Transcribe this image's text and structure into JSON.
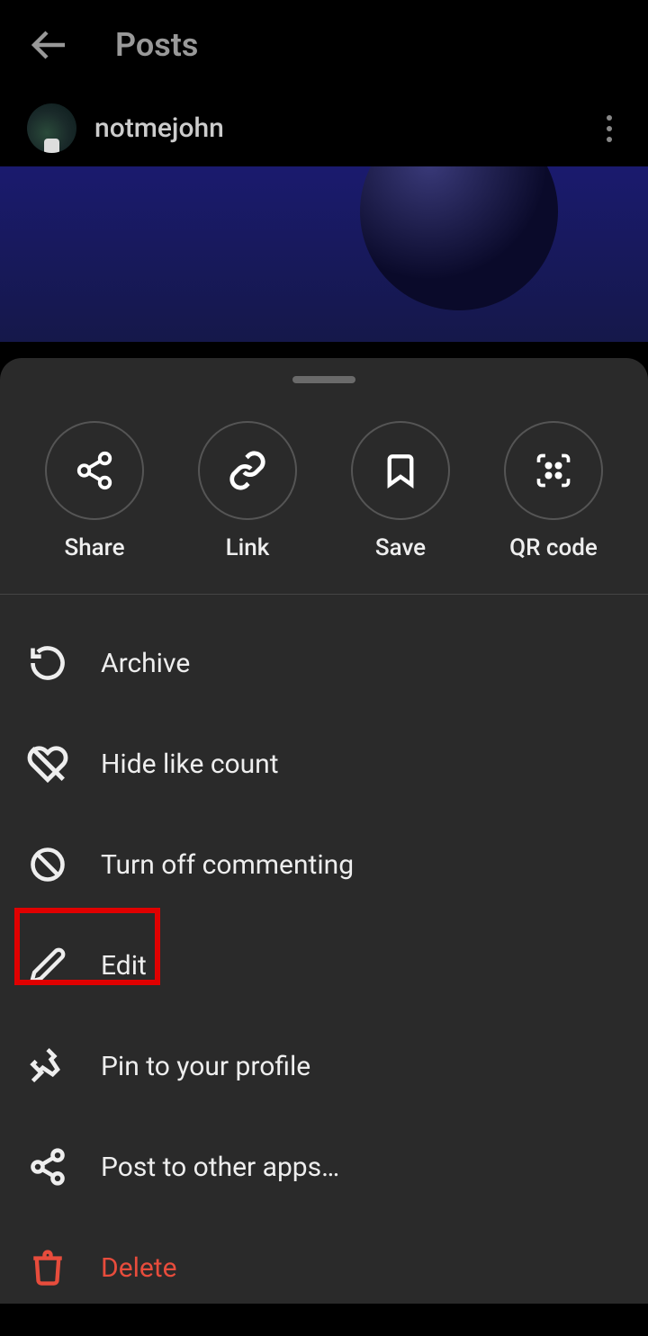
{
  "header": {
    "title": "Posts"
  },
  "post": {
    "username": "notmejohn"
  },
  "sheet": {
    "actions": [
      {
        "label": "Share"
      },
      {
        "label": "Link"
      },
      {
        "label": "Save"
      },
      {
        "label": "QR code"
      }
    ],
    "menu": [
      {
        "label": "Archive"
      },
      {
        "label": "Hide like count"
      },
      {
        "label": "Turn off commenting"
      },
      {
        "label": "Edit"
      },
      {
        "label": "Pin to your profile"
      },
      {
        "label": "Post to other apps…"
      },
      {
        "label": "Delete"
      }
    ]
  },
  "highlight": {
    "target": "edit-menu-item"
  }
}
